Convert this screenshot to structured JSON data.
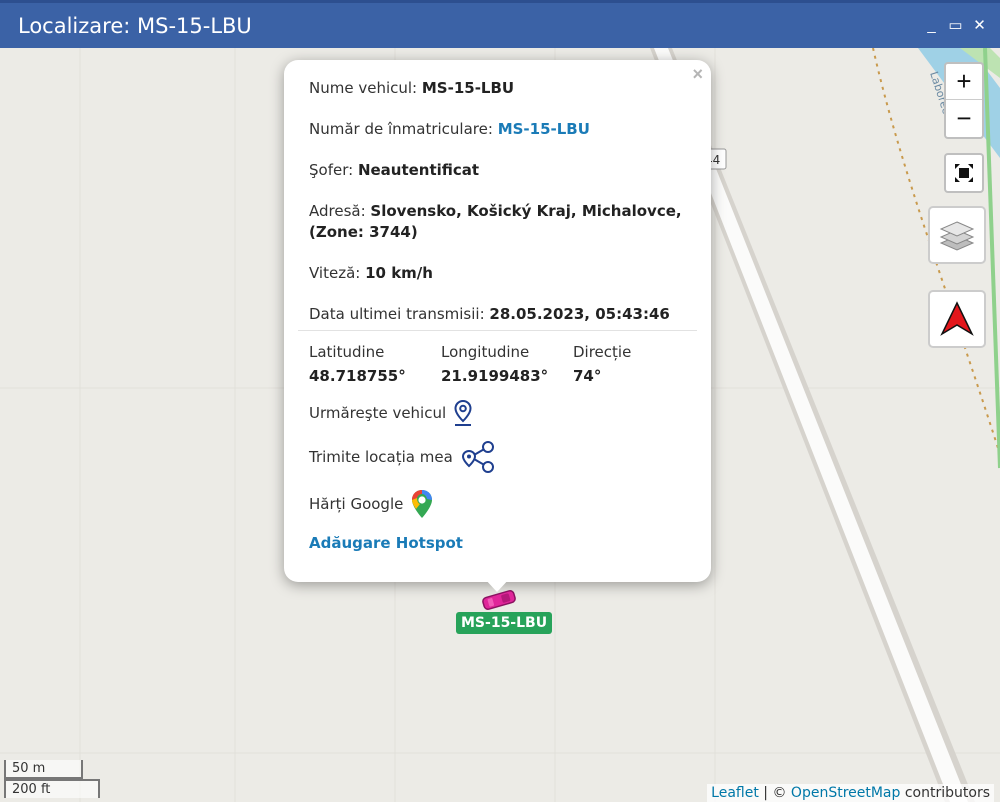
{
  "window": {
    "title": "Localizare: MS-15-LBU",
    "minimize_glyph": "_",
    "maximize_glyph": "▭",
    "close_glyph": "✕"
  },
  "map": {
    "road_number": "44",
    "river_label": "Laborec",
    "controls": {
      "zoom_in": "+",
      "zoom_out": "−",
      "fullscreen_icon": "fullscreen-icon",
      "layers_icon": "layers-icon",
      "north_icon": "north-arrow-icon"
    },
    "scale": {
      "metric": "50 m",
      "imperial": "200 ft"
    },
    "attribution": {
      "leaflet": "Leaflet",
      "sep": " | © ",
      "osm": "OpenStreetMap",
      "suffix": " contributors"
    }
  },
  "popup": {
    "close": "×",
    "vehicle_name_label": "Nume vehicul: ",
    "vehicle_name_value": "MS-15-LBU",
    "plate_label": "Număr de înmatriculare: ",
    "plate_value": "MS-15-LBU",
    "driver_label": "Şofer: ",
    "driver_value": "Neautentificat",
    "address_label": "Adresă: ",
    "address_value_line1": "Slovensko, Košický Kraj, Michalovce,",
    "address_value_line2": "(Zone: 3744)",
    "speed_label": "Viteză: ",
    "speed_value": "10 km/h",
    "last_tx_label": "Data ultimei transmisii: ",
    "last_tx_value": "28.05.2023, 05:43:46",
    "latitude_label": "Latitudine",
    "latitude_value": "48.718755°",
    "longitude_label": "Longitudine",
    "longitude_value": "21.9199483°",
    "direction_label": "Direcție",
    "direction_value": "74°",
    "follow_label": "Urmăreşte vehicul",
    "share_label": "Trimite locația mea",
    "google_label": "Hărți Google",
    "hotspot_label": "Adăugare Hotspot"
  },
  "vehicle": {
    "label": "MS-15-LBU",
    "marker_color": "#e0269a",
    "label_color": "#27a35a"
  }
}
